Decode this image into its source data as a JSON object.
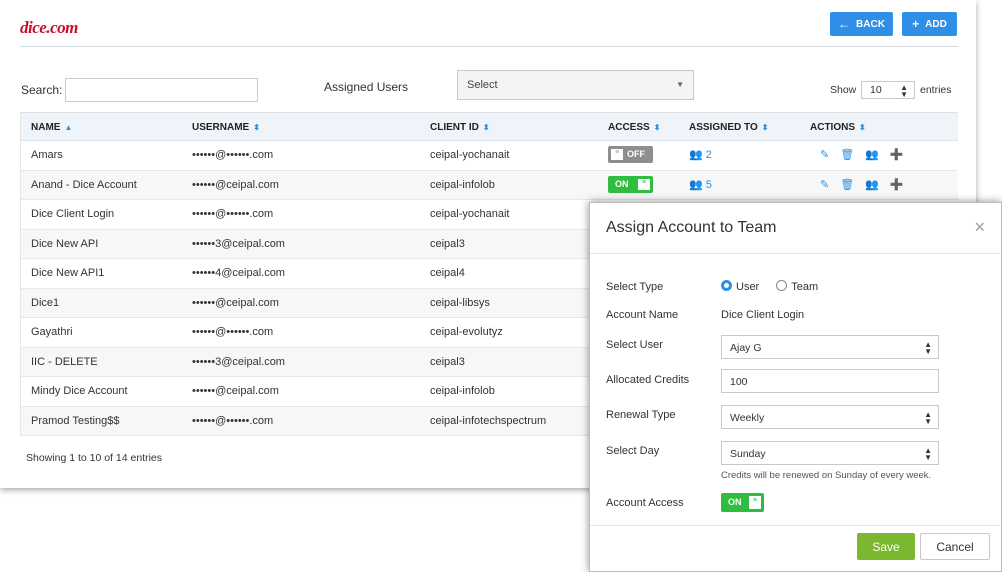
{
  "header": {
    "logo": "dice.com",
    "back_label": "BACK",
    "add_label": "ADD"
  },
  "filters": {
    "search_label": "Search:",
    "search_value": "",
    "assigned_label": "Assigned Users",
    "assigned_select": "Select",
    "show_label": "Show",
    "entries_value": "10",
    "entries_label": "entries"
  },
  "table": {
    "columns": [
      "NAME",
      "USERNAME",
      "CLIENT ID",
      "ACCESS",
      "ASSIGNED TO",
      "ACTIONS"
    ],
    "rows": [
      {
        "name": "Amars",
        "username": "••••••@••••••.com",
        "client": "ceipal-yochanait",
        "access": "OFF",
        "assigned": "2"
      },
      {
        "name": "Anand - Dice Account",
        "username": "••••••@ceipal.com",
        "client": "ceipal-infolob",
        "access": "ON",
        "assigned": "5"
      },
      {
        "name": "Dice Client Login",
        "username": "••••••@••••••.com",
        "client": "ceipal-yochanait"
      },
      {
        "name": "Dice New API",
        "username": "••••••3@ceipal.com",
        "client": "ceipal3"
      },
      {
        "name": "Dice New API1",
        "username": "••••••4@ceipal.com",
        "client": "ceipal4"
      },
      {
        "name": "Dice1",
        "username": "••••••@ceipal.com",
        "client": "ceipal-libsys"
      },
      {
        "name": "Gayathri",
        "username": "••••••@••••••.com",
        "client": "ceipal-evolutyz"
      },
      {
        "name": "IIC - DELETE",
        "username": "••••••3@ceipal.com",
        "client": "ceipal3"
      },
      {
        "name": "Mindy Dice Account",
        "username": "••••••@ceipal.com",
        "client": "ceipal-infolob"
      },
      {
        "name": "Pramod Testing$$",
        "username": "••••••@••••••.com",
        "client": "ceipal-infotechspectrum"
      }
    ],
    "footer": "Showing 1 to 10 of 14 entries"
  },
  "modal": {
    "title": "Assign Account to Team",
    "close": "×",
    "select_type_label": "Select Type",
    "type_user": "User",
    "type_team": "Team",
    "account_name_label": "Account Name",
    "account_name": "Dice Client Login",
    "select_user_label": "Select User",
    "select_user": "Ajay G",
    "credits_label": "Allocated Credits",
    "credits": "100",
    "renewal_label": "Renewal Type",
    "renewal": "Weekly",
    "day_label": "Select Day",
    "day": "Sunday",
    "hint": "Credits will be renewed on Sunday of every week.",
    "access_label": "Account Access",
    "access": "ON",
    "save_label": "Save",
    "cancel_label": "Cancel"
  },
  "colors": {
    "accent": "#2f8fe6",
    "on": "#2ebd3f",
    "save": "#7cb82f",
    "logo": "#c8102e"
  }
}
